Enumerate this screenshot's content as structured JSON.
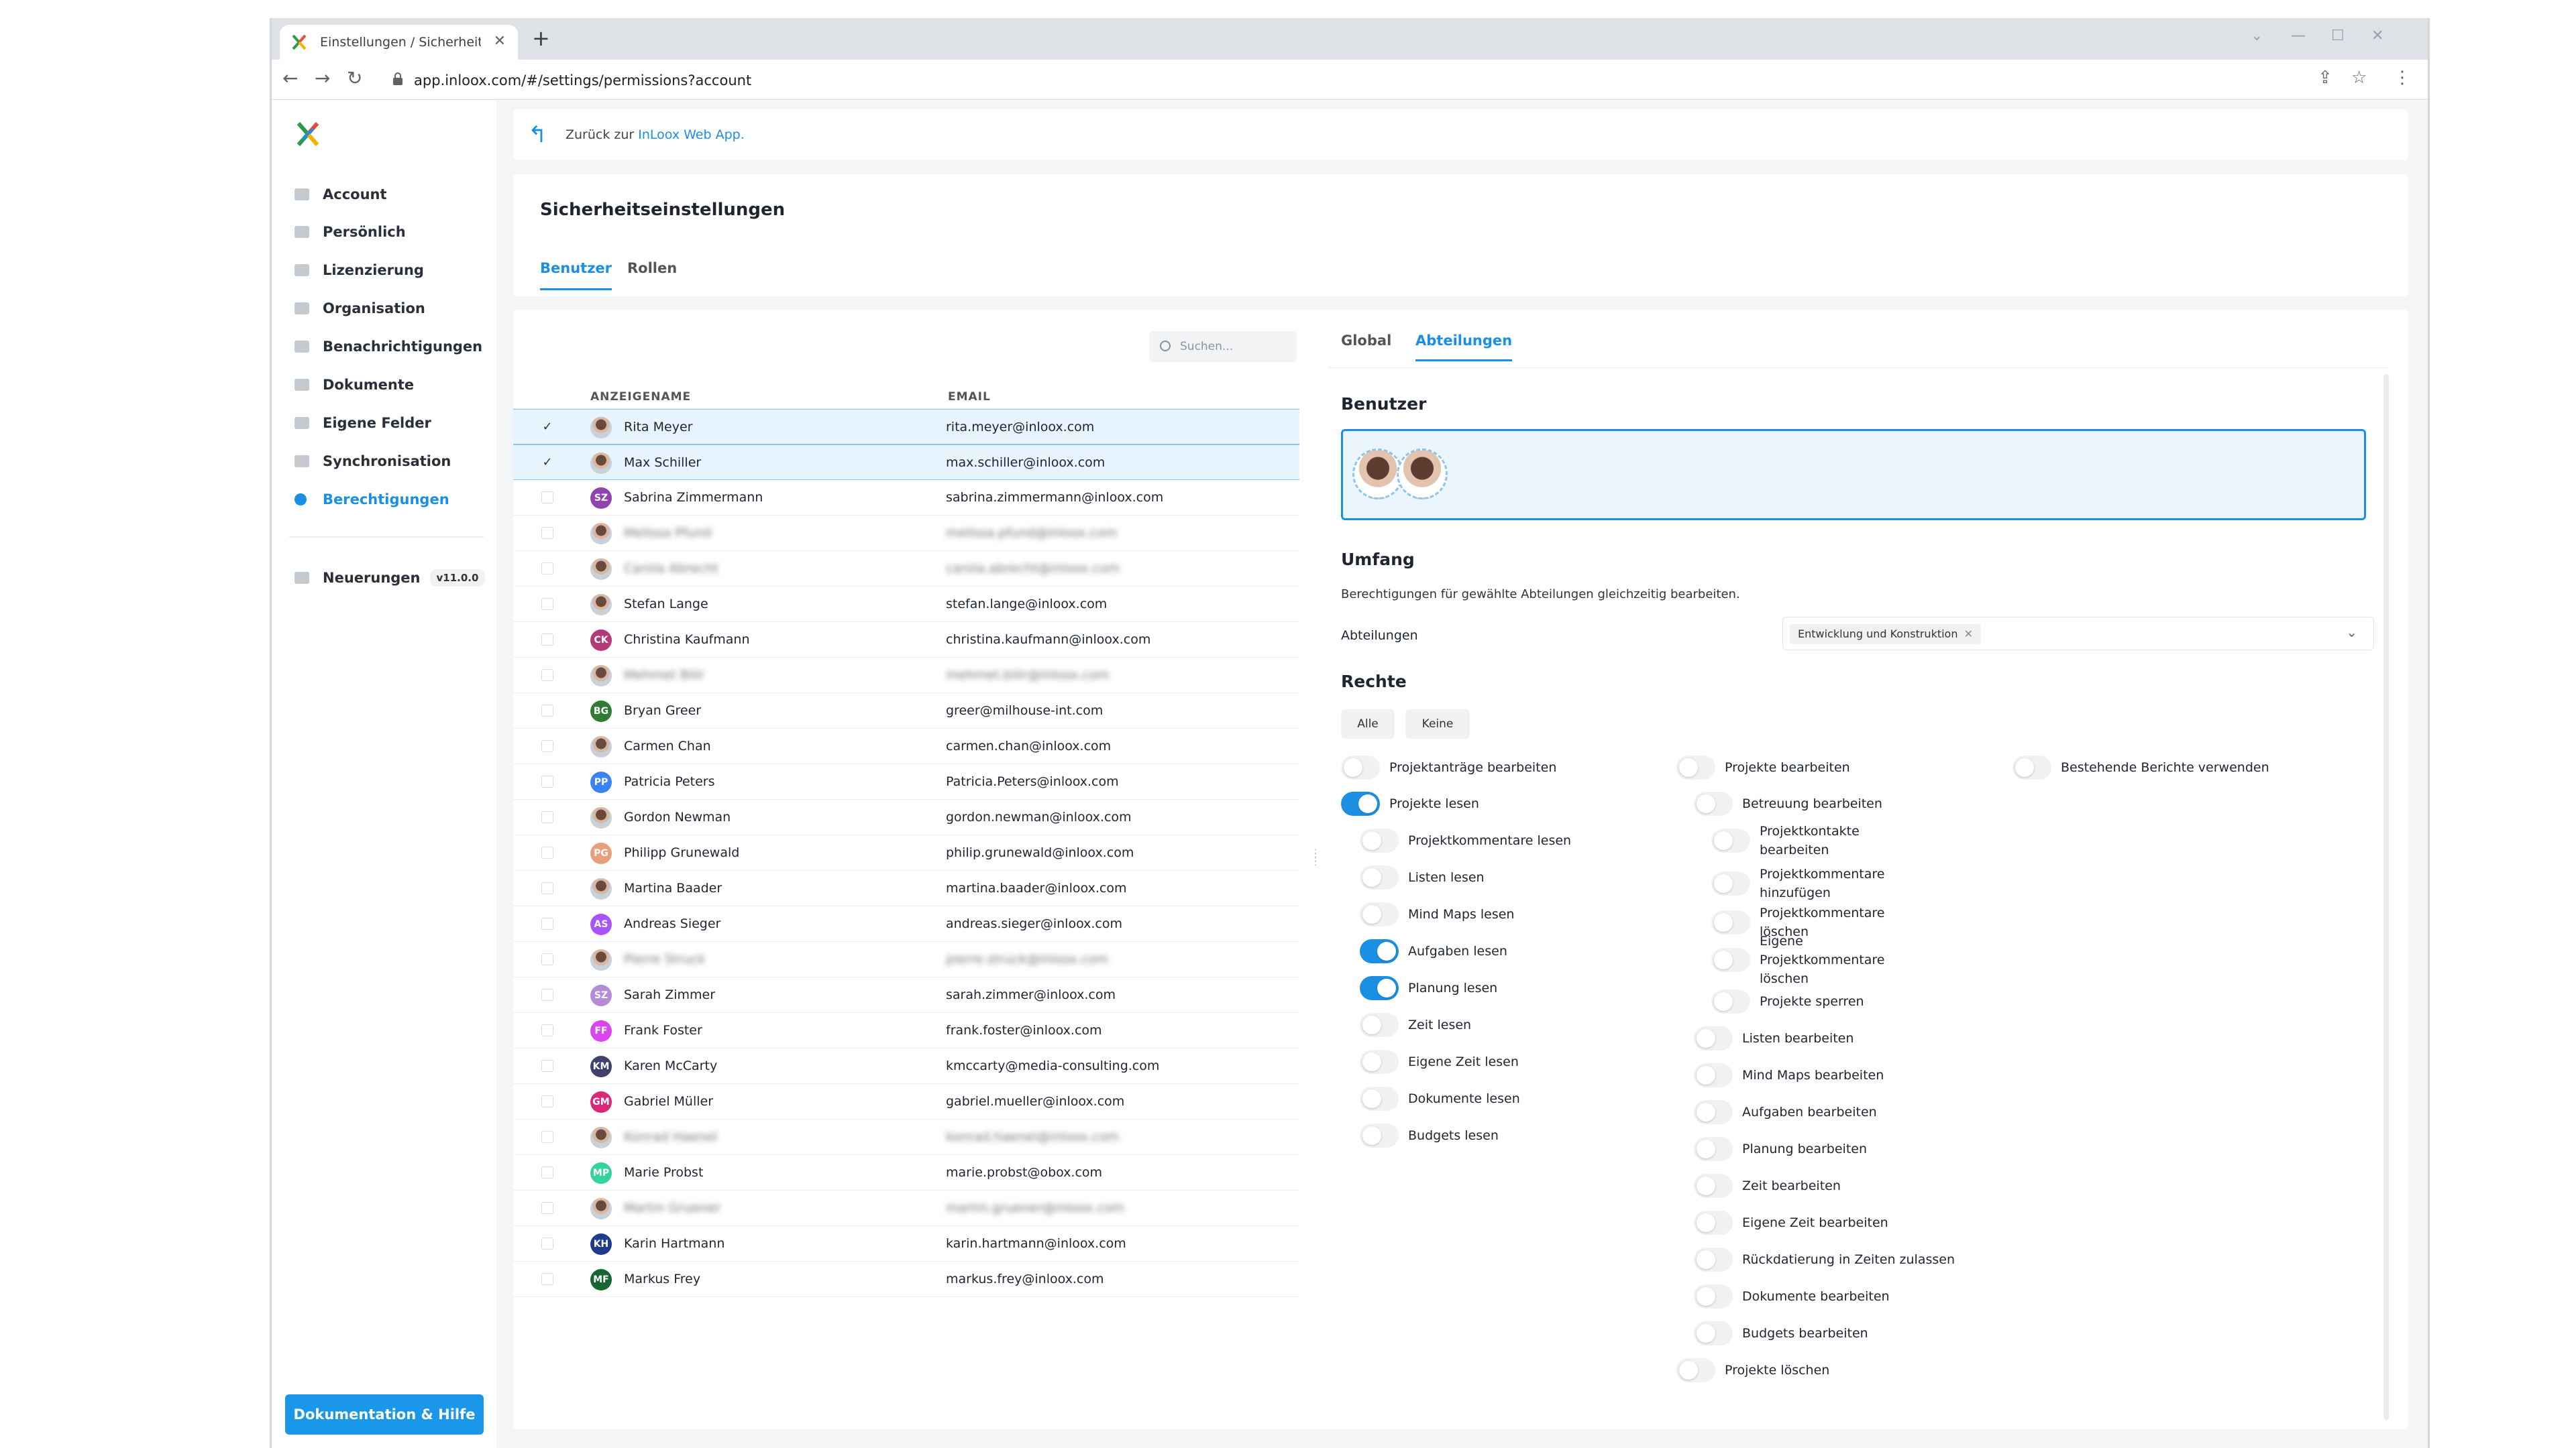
{
  "browser": {
    "tab_title": "Einstellungen / Sicherheitseinste",
    "url": "app.inloox.com/#/settings/permissions?account"
  },
  "sidebar": {
    "items": [
      {
        "label": "Account",
        "icon": "account-icon"
      },
      {
        "label": "Persönlich",
        "icon": "person-icon"
      },
      {
        "label": "Lizenzierung",
        "icon": "license-icon"
      },
      {
        "label": "Organisation",
        "icon": "organisation-icon"
      },
      {
        "label": "Benachrichtigungen",
        "icon": "notification-icon"
      },
      {
        "label": "Dokumente",
        "icon": "folder-icon"
      },
      {
        "label": "Eigene Felder",
        "icon": "custom-fields-icon"
      },
      {
        "label": "Synchronisation",
        "icon": "sync-icon"
      },
      {
        "label": "Berechtigungen",
        "icon": "permissions-icon",
        "active": true
      }
    ],
    "news_label": "Neuerungen",
    "version": "v11.0.0",
    "doc_button": "Dokumentation & Hilfe"
  },
  "back": {
    "prefix": "Zurück zur ",
    "link": "InLoox Web App."
  },
  "security": {
    "title": "Sicherheitseinstellungen",
    "tabs": [
      "Benutzer",
      "Rollen"
    ],
    "active_tab": "Benutzer"
  },
  "users": {
    "search_placeholder": "Suchen...",
    "col_name": "ANZEIGENAME",
    "col_email": "EMAIL",
    "rows": [
      {
        "name": "Rita Meyer",
        "email": "rita.meyer@inloox.com",
        "selected": true,
        "photo": true
      },
      {
        "name": "Max Schiller",
        "email": "max.schiller@inloox.com",
        "selected": true,
        "photo": true
      },
      {
        "name": "Sabrina Zimmermann",
        "email": "sabrina.zimmermann@inloox.com",
        "initials": "SZ",
        "color": "#8e44ad"
      },
      {
        "name": "Melissa Pfund",
        "email": "melissa.pfund@inloox.com",
        "blurred": true,
        "photo": true
      },
      {
        "name": "Carola Abrecht",
        "email": "carola.abrecht@inloox.com",
        "blurred": true,
        "photo": true
      },
      {
        "name": "Stefan Lange",
        "email": "stefan.lange@inloox.com",
        "photo": true
      },
      {
        "name": "Christina Kaufmann",
        "email": "christina.kaufmann@inloox.com",
        "initials": "CK",
        "color": "#b03a7a"
      },
      {
        "name": "Mehmet Bilir",
        "email": "mehmet.bilir@inloox.com",
        "blurred": true,
        "photo": true
      },
      {
        "name": "Bryan Greer",
        "email": "greer@milhouse-int.com",
        "initials": "BG",
        "color": "#2e7d32"
      },
      {
        "name": "Carmen Chan",
        "email": "carmen.chan@inloox.com",
        "photo": true
      },
      {
        "name": "Patricia Peters",
        "email": "Patricia.Peters@inloox.com",
        "initials": "PP",
        "color": "#3b82f6"
      },
      {
        "name": "Gordon Newman",
        "email": "gordon.newman@inloox.com",
        "photo": true
      },
      {
        "name": "Philipp Grunewald",
        "email": "philip.grunewald@inloox.com",
        "initials": "PG",
        "color": "#e8a07c"
      },
      {
        "name": "Martina Baader",
        "email": "martina.baader@inloox.com",
        "photo": true
      },
      {
        "name": "Andreas Sieger",
        "email": "andreas.sieger@inloox.com",
        "initials": "AS",
        "color": "#a855f7"
      },
      {
        "name": "Pierre Struck",
        "email": "pierre.struck@inloox.com",
        "blurred": true,
        "photo": true
      },
      {
        "name": "Sarah Zimmer",
        "email": "sarah.zimmer@inloox.com",
        "initials": "SZ",
        "color": "#b58cd8"
      },
      {
        "name": "Frank Foster",
        "email": "frank.foster@inloox.com",
        "initials": "FF",
        "color": "#d946ef"
      },
      {
        "name": "Karen McCarty",
        "email": "kmccarty@media-consulting.com",
        "initials": "KM",
        "color": "#3f3f6e"
      },
      {
        "name": "Gabriel Müller",
        "email": "gabriel.mueller@inloox.com",
        "initials": "GM",
        "color": "#db2777"
      },
      {
        "name": "Konrad Haenel",
        "email": "konrad.haenel@inloox.com",
        "blurred": true,
        "photo": true
      },
      {
        "name": "Marie Probst",
        "email": "marie.probst@obox.com",
        "initials": "MP",
        "color": "#34d399"
      },
      {
        "name": "Martin Gruener",
        "email": "martin.gruener@inloox.com",
        "blurred": true,
        "photo": true
      },
      {
        "name": "Karin Hartmann",
        "email": "karin.hartmann@inloox.com",
        "initials": "KH",
        "color": "#1e3a8a"
      },
      {
        "name": "Markus Frey",
        "email": "markus.frey@inloox.com",
        "initials": "MF",
        "color": "#166534"
      }
    ]
  },
  "right": {
    "tabs": [
      "Global",
      "Abteilungen"
    ],
    "active_tab": "Abteilungen",
    "users_title": "Benutzer",
    "scope_title": "Umfang",
    "scope_desc": "Berechtigungen für gewählte Abteilungen gleichzeitig bearbeiten.",
    "dept_label": "Abteilungen",
    "dept_chip": "Entwicklung und Konstruktion",
    "rights_title": "Rechte",
    "btn_all": "Alle",
    "btn_none": "Keine"
  },
  "permissions": [
    {
      "label": "Projektanträge bearbeiten",
      "on": false
    },
    {
      "label": "Projekte lesen",
      "on": true
    },
    {
      "label": "Projektkommentare lesen",
      "on": false
    },
    {
      "label": "Listen lesen",
      "on": false
    },
    {
      "label": "Mind Maps lesen",
      "on": false
    },
    {
      "label": "Aufgaben lesen",
      "on": true
    },
    {
      "label": "Planung lesen",
      "on": true
    },
    {
      "label": "Zeit lesen",
      "on": false
    },
    {
      "label": "Eigene Zeit lesen",
      "on": false
    },
    {
      "label": "Dokumente lesen",
      "on": false
    },
    {
      "label": "Budgets lesen",
      "on": false
    },
    {
      "label": "Projekte bearbeiten",
      "on": false
    },
    {
      "label": "Betreuung bearbeiten",
      "on": false
    },
    {
      "label": "Projektkontakte bearbeiten",
      "on": false
    },
    {
      "label": "Projektkommentare hinzufügen",
      "on": false
    },
    {
      "label": "Projektkommentare löschen",
      "on": false
    },
    {
      "label": "Eigene Projektkommentare löschen",
      "on": false
    },
    {
      "label": "Projekte sperren",
      "on": false
    },
    {
      "label": "Listen bearbeiten",
      "on": false
    },
    {
      "label": "Mind Maps bearbeiten",
      "on": false
    },
    {
      "label": "Aufgaben bearbeiten",
      "on": false
    },
    {
      "label": "Planung bearbeiten",
      "on": false
    },
    {
      "label": "Zeit bearbeiten",
      "on": false
    },
    {
      "label": "Eigene Zeit bearbeiten",
      "on": false
    },
    {
      "label": "Rückdatierung in Zeiten zulassen",
      "on": false
    },
    {
      "label": "Dokumente bearbeiten",
      "on": false
    },
    {
      "label": "Budgets bearbeiten",
      "on": false
    },
    {
      "label": "Projekte löschen",
      "on": false
    },
    {
      "label": "Bestehende Berichte verwenden",
      "on": false
    }
  ]
}
